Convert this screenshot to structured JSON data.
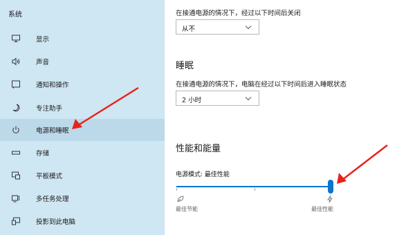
{
  "sidebar": {
    "header": "系统",
    "items": [
      {
        "label": "显示",
        "icon": "monitor-icon"
      },
      {
        "label": "声音",
        "icon": "speaker-icon"
      },
      {
        "label": "通知和操作",
        "icon": "notification-icon"
      },
      {
        "label": "专注助手",
        "icon": "moon-icon"
      },
      {
        "label": "电源和睡眠",
        "icon": "power-icon",
        "selected": true
      },
      {
        "label": "存储",
        "icon": "storage-icon"
      },
      {
        "label": "平板模式",
        "icon": "tablet-icon"
      },
      {
        "label": "多任务处理",
        "icon": "multitask-icon"
      },
      {
        "label": "投影到此电脑",
        "icon": "project-icon"
      }
    ]
  },
  "screen": {
    "description": "在接通电源的情况下，经过以下时间后关闭",
    "value": "从不"
  },
  "sleep": {
    "title": "睡眠",
    "description": "在接通电源的情况下，电脑在经过以下时间后进入睡眠状态",
    "value": "2 小时"
  },
  "performance": {
    "title": "性能和能量",
    "mode_label": "电源模式: 最佳性能",
    "slider_value_fraction": 1.0,
    "left_label": "最佳节能",
    "right_label": "最佳性能",
    "left_icon": "leaf-icon",
    "right_icon": "lightning-icon"
  },
  "annotations": {
    "arrow_color": "#e8231b"
  },
  "colors": {
    "sidebar_bg": "#cfe6f3",
    "accent": "#0a74cf"
  }
}
